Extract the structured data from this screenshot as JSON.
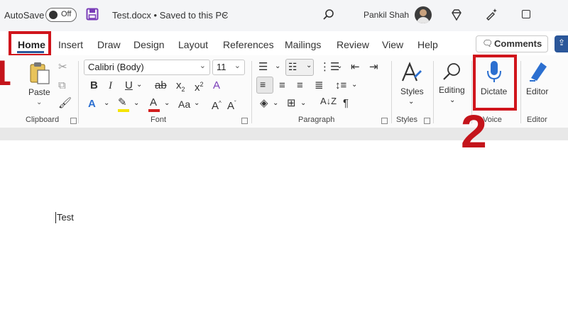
{
  "titlebar": {
    "autosave_label": "AutoSave",
    "autosave_state": "Off",
    "doc_title": "Test.docx • Saved to this PC",
    "user_name": "Pankil Shah"
  },
  "tabs": [
    "Home",
    "Insert",
    "Draw",
    "Design",
    "Layout",
    "References",
    "Mailings",
    "Review",
    "View",
    "Help"
  ],
  "comments_label": "Comments",
  "clipboard": {
    "paste_label": "Paste",
    "group_label": "Clipboard"
  },
  "font": {
    "name": "Calibri (Body)",
    "size": "11",
    "group_label": "Font",
    "case_label": "Aa"
  },
  "paragraph": {
    "group_label": "Paragraph"
  },
  "styles": {
    "label": "Styles",
    "group_label": "Styles"
  },
  "editing": {
    "label": "Editing"
  },
  "voice": {
    "dictate_label": "Dictate",
    "group_label": "Voice"
  },
  "editor": {
    "label": "Editor",
    "group_label": "Editor"
  },
  "annotations": {
    "step1": "1",
    "step2": "2"
  },
  "document": {
    "text": "Test"
  },
  "colors": {
    "accent": "#2b579a",
    "annotation_red": "#c4141b",
    "highlight_yellow": "#f5e400",
    "font_red": "#d21f1f"
  }
}
